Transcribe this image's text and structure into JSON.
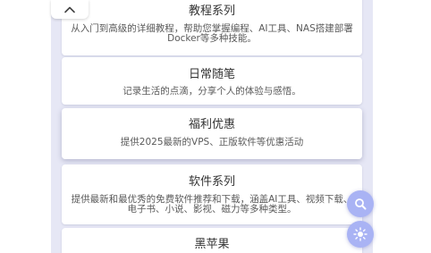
{
  "categories": [
    {
      "title": "教程系列",
      "description": "从入门到高级的详细教程，帮助您掌握编程、AI工具、NAS搭建部署Docker等多种技能。"
    },
    {
      "title": "日常随笔",
      "description": "记录生活的点滴，分享个人的体验与感悟。"
    },
    {
      "title": "福利优惠",
      "description": "提供2025最新的VPS、正版软件等优惠活动"
    },
    {
      "title": "软件系列",
      "description": "提供最新和最优秀的免费软件推荐和下载，涵盖AI工具、视频下载、电子书、小说、影视、磁力等多种类型。"
    },
    {
      "title": "黑苹果",
      "description": ""
    }
  ],
  "controls": {
    "collapse_icon": "chevron-up-icon",
    "search_icon": "search-icon",
    "theme_icon": "sun-icon"
  },
  "colors": {
    "background": "#e6e7f5",
    "card": "#ffffff",
    "fab": "#a9b3f4"
  }
}
